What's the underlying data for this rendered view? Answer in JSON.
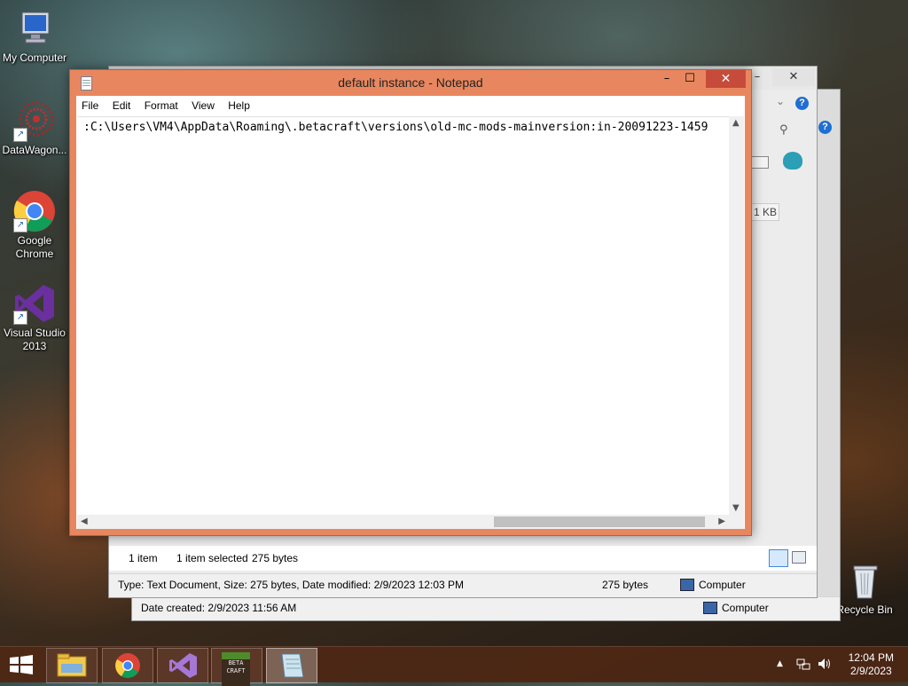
{
  "desktop": {
    "icons": [
      {
        "label": "My Computer",
        "icon": "computer-icon"
      },
      {
        "label": "DataWagon...",
        "icon": "datawagon-icon"
      },
      {
        "label": "Google Chrome",
        "icon": "chrome-icon"
      },
      {
        "label": "Visual Studio 2013",
        "icon": "visual-studio-icon"
      },
      {
        "label": "Recycle Bin",
        "icon": "recycle-bin-icon"
      }
    ]
  },
  "explorer_back": {
    "status_date_created": "Date created: 2/9/2023 11:56 AM",
    "status_computer": "Computer"
  },
  "explorer_front": {
    "size_badge": "1 KB",
    "item_count": "1 item",
    "item_selected": "1 item selected",
    "item_size": "275 bytes",
    "details_status": "Type: Text Document, Size: 275 bytes, Date modified: 2/9/2023 12:03 PM",
    "details_size": "275 bytes",
    "details_computer": "Computer"
  },
  "notepad": {
    "title": "default instance - Notepad",
    "menu": [
      "File",
      "Edit",
      "Format",
      "View",
      "Help"
    ],
    "content": ":C:\\Users\\VM4\\AppData\\Roaming\\.betacraft\\versions\\old-mc-mods-mainversion:in-20091223-1459"
  },
  "taskbar": {
    "apps": [
      "start-icon",
      "file-explorer-icon",
      "chrome-icon",
      "visual-studio-icon",
      "betacraft-icon",
      "notepad-icon"
    ],
    "time": "12:04 PM",
    "date": "2/9/2023"
  },
  "colors": {
    "notepad_frame": "#e8875f",
    "close_button": "#c74b3a",
    "taskbar": "#50281a"
  }
}
